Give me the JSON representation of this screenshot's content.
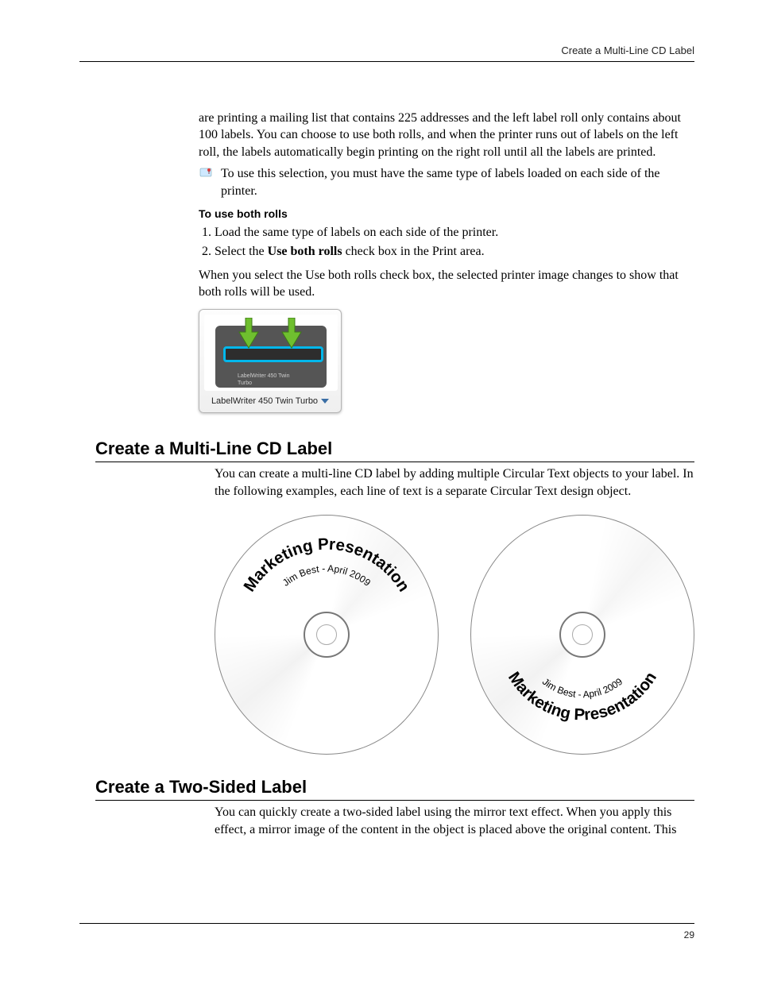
{
  "header": {
    "running_title": "Create a Multi-Line CD Label"
  },
  "intro": {
    "continuation_para": "are printing a mailing list that contains 225 addresses and the left label roll only contains about 100 labels. You can choose to use both rolls, and when the printer runs out of labels on the left roll, the labels automatically begin printing on the right roll until all the labels are printed.",
    "note_text": "To use this selection, you must have the same type of labels loaded on each side of the printer.",
    "steps_heading": "To use both rolls",
    "steps": [
      "Load the same type of labels on each side of the printer.",
      "Select the "
    ],
    "step2_bold": "Use both rolls",
    "step2_tail": " check box in the Print area.",
    "after_steps_para": "When you select the Use both rolls check box, the selected printer image changes to show that both rolls will be used."
  },
  "printer_selector": {
    "caption_on_device": "LabelWriter 450 Twin Turbo",
    "dropdown_label": "LabelWriter 450 Twin Turbo"
  },
  "section_cd": {
    "heading": "Create a Multi-Line CD Label",
    "para": "You can create a multi-line CD label by adding multiple Circular Text objects to your label. In the following examples, each line of text is a separate Circular Text design object.",
    "cd_big_text": "Marketing Presentation",
    "cd_small_text": "Jim Best - April 2009"
  },
  "section_two_sided": {
    "heading": "Create a Two-Sided Label",
    "para": "You can quickly create a two-sided label using the mirror text effect. When you apply this effect, a mirror image of the content in the object is placed above the original content. This"
  },
  "footer": {
    "page_number": "29"
  }
}
